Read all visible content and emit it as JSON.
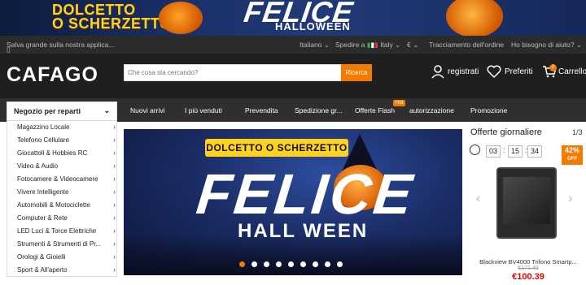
{
  "banner": {
    "left_text": "DOLCETTO\nO SCHERZETTO",
    "title": "FELICE",
    "subtitle": "HALLOWEEN"
  },
  "utility": {
    "app_text": "Salva grande sulla nostra applica...",
    "language": "Italiano",
    "ship_to": "Spedire a",
    "country": "Italy",
    "currency": "€",
    "order_tracking": "Tracciamento dell'ordine",
    "help": "Ho bisogno di aiuto?"
  },
  "header": {
    "logo": "CAFAGO",
    "search_placeholder": "Che cosa sta cercando?",
    "search_button": "Ricerca",
    "register": "registrati",
    "wishlist": "Preferiti",
    "cart": "Carrello",
    "cart_count": "0"
  },
  "nav": {
    "category_header": "Negozio per reparti",
    "items": [
      "Nuovi arrivi",
      "I più venduti",
      "Prevendita",
      "Spedizione gr...",
      "Offerte Flash",
      "autorizzazione",
      "Promozione"
    ],
    "hot_badge": "Hot"
  },
  "categories": [
    "Magazzino Locale",
    "Telefono Cellulare",
    "Giocattoli & Hobbies RC",
    "Video & Audio",
    "Fotocamere & Videocamere",
    "Vivere Intelligente",
    "Automobili & Motociclette",
    "Computer & Rete",
    "LED Luci & Torce Elettriche",
    "Strumenti & Strumenti di Pr...",
    "Orologi & Gioielli",
    "Sport & All'aperto"
  ],
  "hero": {
    "top_label": "DOLCETTO O SCHERZETTO",
    "title": "FELICE",
    "subtitle": "HALL WEEN",
    "slide_count": 9,
    "active_slide": 1
  },
  "deals": {
    "title": "Offerte giornaliere",
    "page": "1/3",
    "timer": {
      "h": "03",
      "m": "15",
      "s": "34"
    },
    "discount": "42%",
    "discount_label": "OFF",
    "product_name": "Blackview BV4000 Trifono Smartp...",
    "old_price": "€171.40",
    "price": "€100.39"
  },
  "colors": {
    "accent": "#f57b00",
    "header_bg": "#1f1f1f",
    "nav_bg": "#2f2f2f",
    "price_red": "#e00000"
  }
}
